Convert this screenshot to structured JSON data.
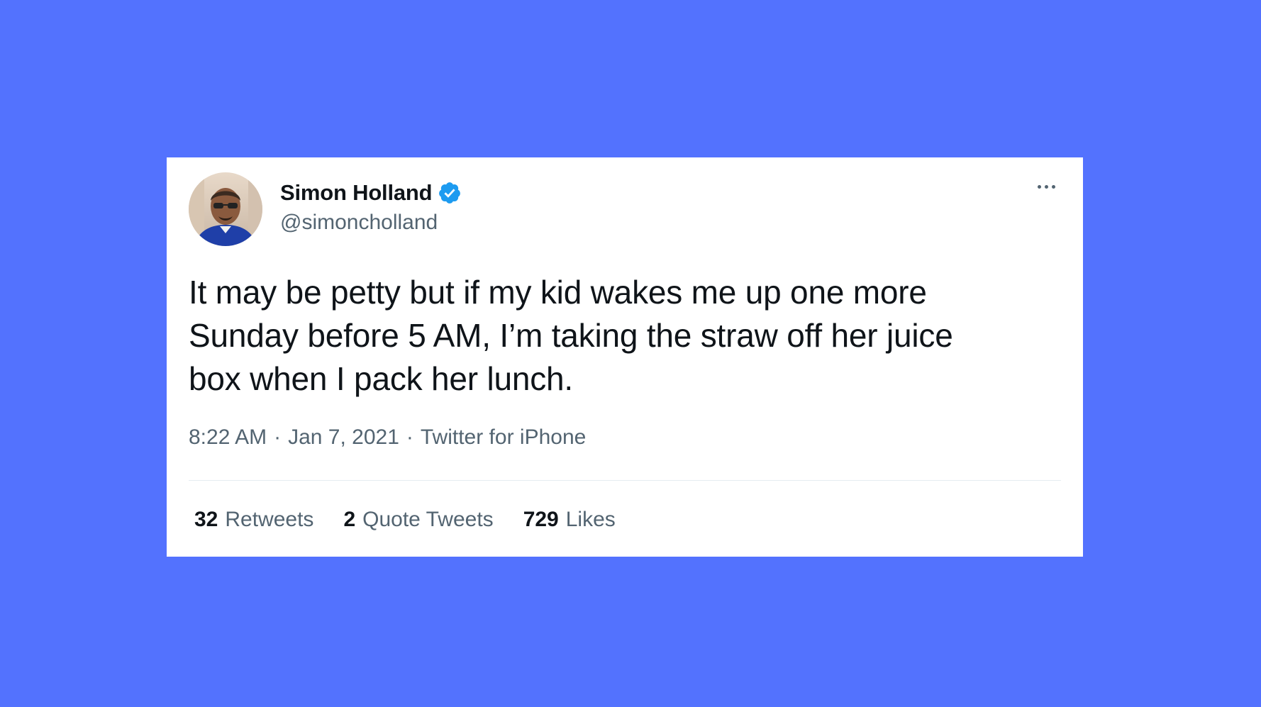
{
  "tweet": {
    "author": {
      "name": "Simon Holland",
      "handle": "@simoncholland",
      "verified": true
    },
    "text": "It may be petty but if my kid wakes me up one more\nSunday before 5 AM, I’m taking the straw off her juice\nbox when I pack her lunch.",
    "time": "8:22 AM",
    "date": "Jan 7, 2021",
    "source": "Twitter for iPhone",
    "separator": "·",
    "stats": [
      {
        "count": "32",
        "label": "Retweets"
      },
      {
        "count": "2",
        "label": "Quote Tweets"
      },
      {
        "count": "729",
        "label": "Likes"
      }
    ]
  },
  "icons": {
    "verified": "verified-badge-icon",
    "more": "more-options-icon"
  },
  "colors": {
    "background": "#5372FE",
    "card": "#FFFFFF",
    "text_primary": "#0F1419",
    "text_secondary": "#536471",
    "verified": "#1D9BF0"
  }
}
